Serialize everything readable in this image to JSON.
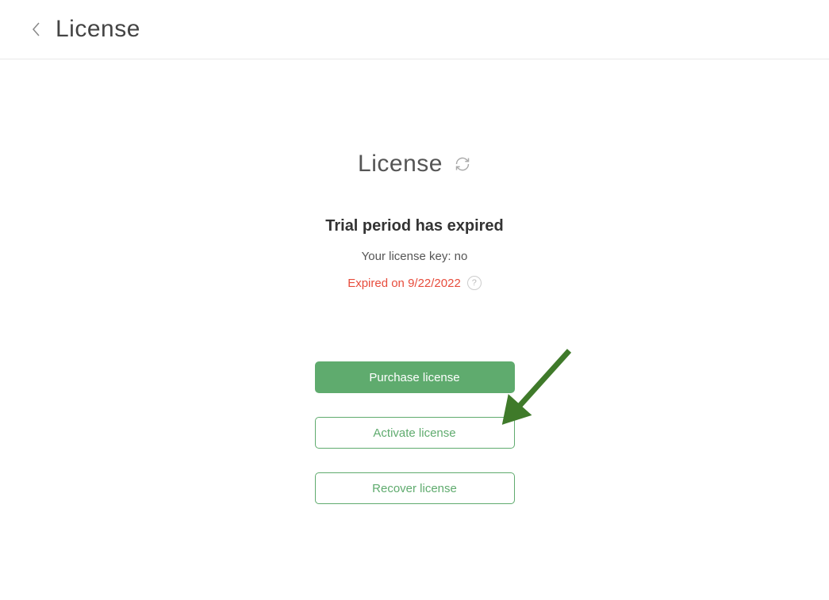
{
  "header": {
    "title": "License"
  },
  "section": {
    "title": "License"
  },
  "status": {
    "heading": "Trial period has expired",
    "license_key_text": "Your license key: no",
    "expired_text": "Expired on 9/22/2022",
    "help_symbol": "?"
  },
  "buttons": {
    "purchase": "Purchase license",
    "activate": "Activate license",
    "recover": "Recover license"
  }
}
